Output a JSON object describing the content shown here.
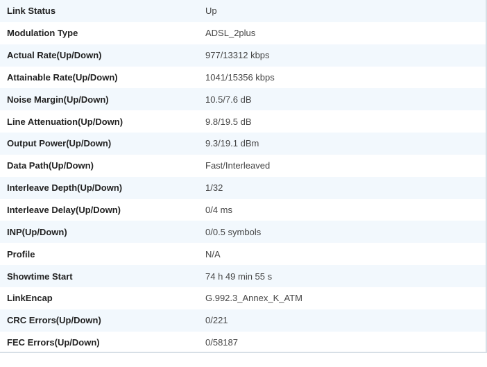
{
  "rows": [
    {
      "label": "Link Status",
      "value": "Up"
    },
    {
      "label": "Modulation Type",
      "value": "ADSL_2plus"
    },
    {
      "label": "Actual Rate(Up/Down)",
      "value": "977/13312 kbps"
    },
    {
      "label": "Attainable Rate(Up/Down)",
      "value": "1041/15356 kbps"
    },
    {
      "label": "Noise Margin(Up/Down)",
      "value": "10.5/7.6 dB"
    },
    {
      "label": "Line Attenuation(Up/Down)",
      "value": "9.8/19.5 dB"
    },
    {
      "label": "Output Power(Up/Down)",
      "value": "9.3/19.1 dBm"
    },
    {
      "label": "Data Path(Up/Down)",
      "value": "Fast/Interleaved"
    },
    {
      "label": "Interleave Depth(Up/Down)",
      "value": "1/32"
    },
    {
      "label": "Interleave Delay(Up/Down)",
      "value": "0/4 ms"
    },
    {
      "label": "INP(Up/Down)",
      "value": "0/0.5 symbols"
    },
    {
      "label": "Profile",
      "value": "N/A"
    },
    {
      "label": "Showtime Start",
      "value": "74 h 49 min 55 s"
    },
    {
      "label": "LinkEncap",
      "value": "G.992.3_Annex_K_ATM"
    },
    {
      "label": "CRC Errors(Up/Down)",
      "value": "0/221"
    },
    {
      "label": "FEC Errors(Up/Down)",
      "value": "0/58187"
    }
  ]
}
